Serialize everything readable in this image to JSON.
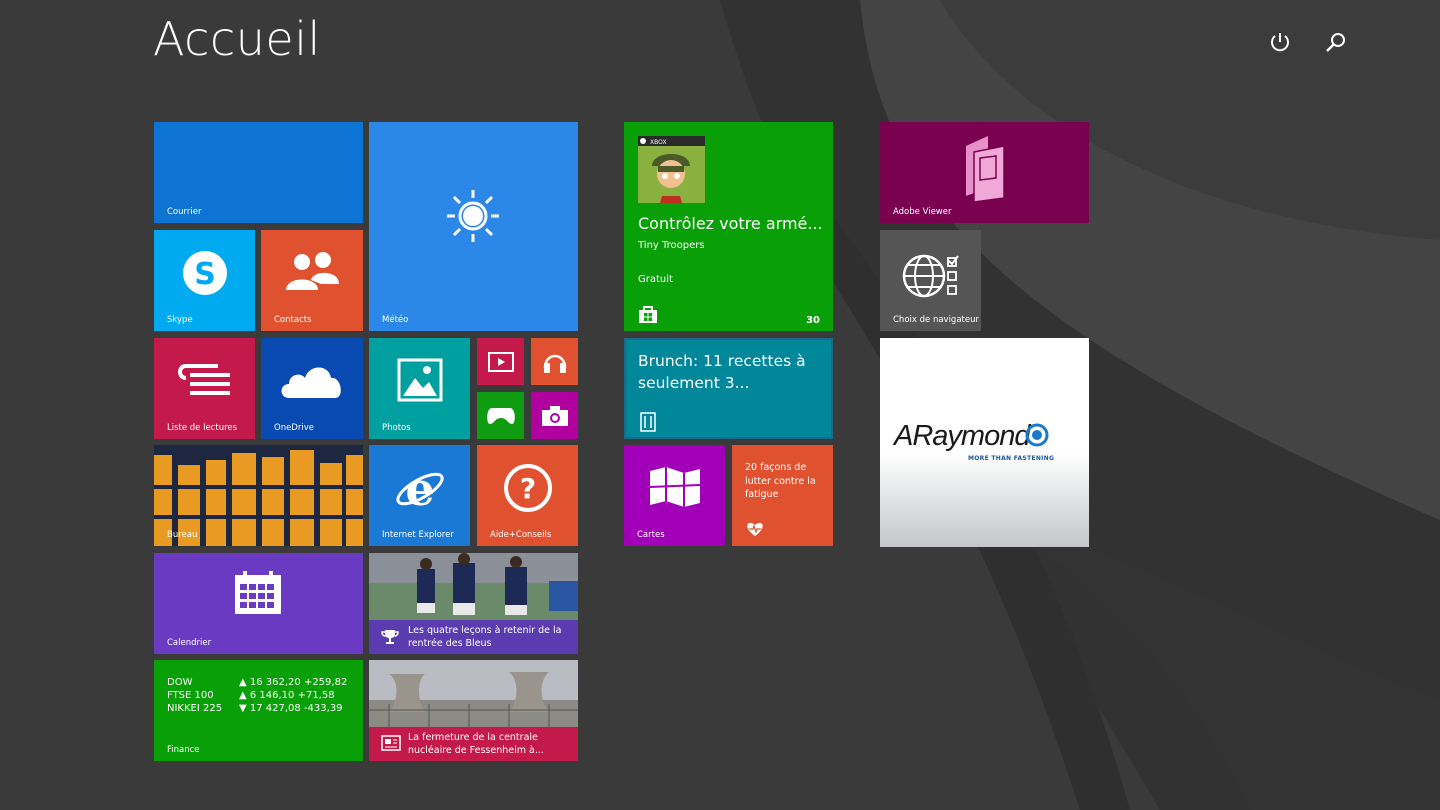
{
  "screen": {
    "title": "Accueil"
  },
  "colors": {
    "background": "#3a3a3a",
    "mail": "#0d74d4",
    "weather": "#2b88e8",
    "skype": "#00aaf0",
    "contacts": "#e0512f",
    "reading": "#c4194b",
    "onedrive": "#094ab2",
    "photos": "#00a0a0",
    "video": "#c4194b",
    "music": "#e0512f",
    "games": "#109c10",
    "camera": "#b1009f",
    "desktop": "#e08a1a",
    "ie": "#1b79d6",
    "help": "#e0512f",
    "calendar": "#6a3bc2",
    "sport": "#5b3bb0",
    "finance": "#08a006",
    "news": "#c4194b",
    "store": "#08a006",
    "food": "#00889a",
    "maps": "#a200b8",
    "health": "#e0512f",
    "adobe": "#7a0050",
    "browser": "#555555"
  },
  "tiles": {
    "mail": {
      "label": "Courrier",
      "icon": "envelope-icon"
    },
    "weather": {
      "label": "Météo",
      "icon": "sun-icon"
    },
    "skype": {
      "label": "Skype",
      "icon": "skype-icon"
    },
    "contacts": {
      "label": "Contacts",
      "icon": "people-icon"
    },
    "reading": {
      "label": "Liste de lectures",
      "icon": "reading-list-icon"
    },
    "onedrive": {
      "label": "OneDrive",
      "icon": "cloud-icon"
    },
    "photos": {
      "label": "Photos",
      "icon": "picture-icon"
    },
    "video": {
      "icon": "video-icon"
    },
    "music": {
      "icon": "headphones-icon"
    },
    "games": {
      "icon": "gamepad-icon"
    },
    "camera": {
      "icon": "camera-icon"
    },
    "desktop": {
      "label": "Bureau"
    },
    "ie": {
      "label": "Internet Explorer",
      "icon": "internet-explorer-icon"
    },
    "help": {
      "label": "Aide+Conseils",
      "icon": "question-icon"
    },
    "calendar": {
      "label": "Calendrier",
      "icon": "calendar-icon"
    },
    "sport": {
      "caption": "Les quatre leçons à retenir de la rentrée des Bleus",
      "icon": "trophy-icon"
    },
    "finance": {
      "label": "Finance",
      "rows": [
        {
          "name": "DOW",
          "value": "▲ 16 362,20 +259,82"
        },
        {
          "name": "FTSE 100",
          "value": "▲ 6 146,10 +71,58"
        },
        {
          "name": "NIKKEI 225",
          "value": "▼ 17 427,08 -433,39"
        }
      ]
    },
    "news": {
      "caption": "La fermeture de la centrale nucléaire de Fessenheim à...",
      "icon": "newspaper-icon"
    },
    "store": {
      "badge": "XBOX",
      "headline": "Contrôlez votre armé...",
      "app": "Tiny Troopers",
      "price": "Gratuit",
      "count": "30",
      "icon": "store-bag-icon"
    },
    "food": {
      "headline": "Brunch: 11 recettes à seulement 3...",
      "icon": "fork-knife-icon"
    },
    "maps": {
      "label": "Cartes",
      "icon": "map-icon"
    },
    "health": {
      "text": "20 façons de lutter contre la fatigue",
      "icon": "heart-pulse-icon"
    },
    "adobe": {
      "label": "Adobe Viewer",
      "icon": "adobe-viewer-icon"
    },
    "browser": {
      "label": "Choix de navigateur",
      "icon": "globe-checklist-icon"
    },
    "araymond": {
      "brand": "ARaymond",
      "tagline": "MORE THAN FASTENING"
    }
  },
  "top_bar": {
    "power_icon": "power-icon",
    "search_icon": "search-icon"
  }
}
